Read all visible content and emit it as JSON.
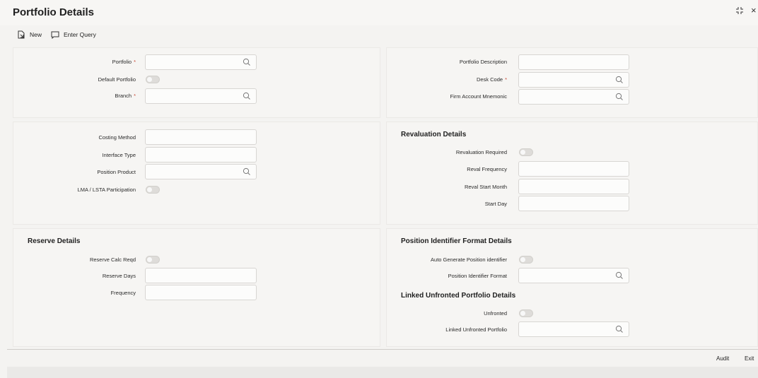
{
  "window": {
    "title": "Portfolio Details",
    "controls": {
      "expand_icon": "expand-arrows-icon",
      "close_glyph": "×"
    }
  },
  "toolbar": {
    "new_label": "New",
    "enter_query_label": "Enter Query"
  },
  "portfolio_section": {
    "portfolio_label": "Portfolio",
    "portfolio_value": "",
    "default_portfolio_label": "Default Portfolio",
    "default_portfolio_on": false,
    "branch_label": "Branch",
    "branch_value": "",
    "required_mark": "*"
  },
  "desk_section": {
    "portfolio_description_label": "Portfolio Description",
    "portfolio_description_value": "",
    "desk_code_label": "Desk Code",
    "desk_code_value": "",
    "firm_account_mnemonic_label": "Firm Account Mnemonic",
    "firm_account_mnemonic_value": ""
  },
  "costing_section": {
    "costing_method_label": "Costing Method",
    "costing_method_value": "",
    "interface_type_label": "Interface Type",
    "interface_type_value": "",
    "position_product_label": "Position Product",
    "position_product_value": "",
    "lma_lsta_label": "LMA / LSTA Participation",
    "lma_lsta_on": false
  },
  "revaluation_section": {
    "title": "Revaluation Details",
    "revaluation_required_label": "Revaluation Required",
    "revaluation_required_on": false,
    "reval_frequency_label": "Reval Frequency",
    "reval_frequency_value": "",
    "reval_start_month_label": "Reval Start Month",
    "reval_start_month_value": "",
    "start_day_label": "Start Day",
    "start_day_value": ""
  },
  "reserve_section": {
    "title": "Reserve Details",
    "reserve_calc_reqd_label": "Reserve Calc Reqd",
    "reserve_calc_reqd_on": false,
    "reserve_days_label": "Reserve Days",
    "reserve_days_value": "",
    "frequency_label": "Frequency",
    "frequency_value": ""
  },
  "position_identifier_section": {
    "title": "Position Identifier Format Details",
    "auto_generate_label": "Auto Generate Position identifier",
    "auto_generate_on": false,
    "format_label": "Position Identifier Format",
    "format_value": ""
  },
  "unfronted_section": {
    "title": "Linked Unfronted Portfolio Details",
    "unfronted_label": "Unfronted",
    "unfronted_on": false,
    "linked_unfronted_portfolio_label": "Linked Unfronted Portfolio",
    "linked_unfronted_portfolio_value": ""
  },
  "footer": {
    "audit_label": "Audit",
    "exit_label": "Exit"
  },
  "colors": {
    "required": "#c74634",
    "panel_bg": "#f6f5f3",
    "page_bg": "#f4f3f1"
  }
}
